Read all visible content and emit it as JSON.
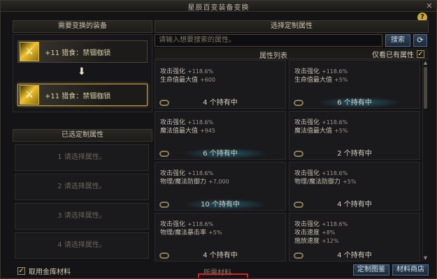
{
  "window": {
    "title": "星辰百变装备变换",
    "close_icon": "close-icon",
    "help_label": "?"
  },
  "left": {
    "equip_header": "需要变换的装备",
    "source_item": {
      "icon": "sword-icon",
      "label": "+11 猎食：禁锢枷锁"
    },
    "target_item": {
      "icon": "sword-icon",
      "label": "+11 猎食：禁锢枷锁"
    },
    "arrow_icon": "arrow-down-icon",
    "selected_header": "已选定制属性",
    "selected_slots": [
      "1 请选择属性。",
      "2 请选择属性。",
      "3 请选择属性。",
      "4 请选择属性。"
    ]
  },
  "right": {
    "header": "选择定制属性",
    "search": {
      "placeholder": "请输入想要搜索的属性。",
      "button": "搜索",
      "refresh_icon": "refresh-icon"
    },
    "list_title": "属性列表",
    "owned_only": {
      "label": "仅看已有属性",
      "checked": true
    },
    "cards": [
      {
        "attrs": [
          {
            "name": "攻击强化",
            "value": "+118.6%"
          },
          {
            "name": "生命值最大值",
            "value": "+600"
          }
        ],
        "owned": "4 个持有中",
        "glow": false
      },
      {
        "attrs": [
          {
            "name": "攻击强化",
            "value": "+118.6%"
          },
          {
            "name": "生命值最大值",
            "value": "+5%"
          }
        ],
        "owned": "6 个持有中",
        "glow": true
      },
      {
        "attrs": [
          {
            "name": "攻击强化",
            "value": "+118.6%"
          },
          {
            "name": "魔法值最大值",
            "value": "+945"
          }
        ],
        "owned": "6 个持有中",
        "glow": true
      },
      {
        "attrs": [
          {
            "name": "攻击强化",
            "value": "+118.6%"
          },
          {
            "name": "魔法值最大值",
            "value": "+5%"
          }
        ],
        "owned": "2 个持有中",
        "glow": false
      },
      {
        "attrs": [
          {
            "name": "攻击强化",
            "value": "+118.6%"
          },
          {
            "name": "物理/魔法防御力",
            "value": "+7,000"
          }
        ],
        "owned": "10 个持有中",
        "glow": true
      },
      {
        "attrs": [
          {
            "name": "攻击强化",
            "value": "+118.6%"
          },
          {
            "name": "物理/魔法防御力",
            "value": "+5%"
          }
        ],
        "owned": "4 个持有中",
        "glow": false
      },
      {
        "attrs": [
          {
            "name": "攻击强化",
            "value": "+118.6%"
          },
          {
            "name": "物理/魔法暴击率",
            "value": "+5%"
          }
        ],
        "owned": "4 个持有中",
        "glow": false
      },
      {
        "attrs": [
          {
            "name": "攻击强化",
            "value": "+118.6%"
          },
          {
            "name": "攻击速度",
            "value": "+8%"
          },
          {
            "name": "施放速度",
            "value": "+12%"
          }
        ],
        "owned": "4 个持有中",
        "glow": false
      }
    ]
  },
  "bottom": {
    "bank_materials": {
      "label": "取用金库材料",
      "checked": true
    },
    "materials_label": "所需材料",
    "buttons": [
      "定制图鉴",
      "材料商店"
    ]
  }
}
